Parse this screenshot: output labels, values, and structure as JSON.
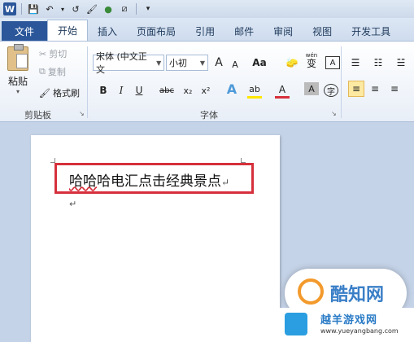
{
  "qat": {
    "app_icon": "W",
    "save_icon": "💾",
    "undo_icon": "↶",
    "undo_arrow": "▾",
    "redo_icon": "↺",
    "format_painter_icon": "🖌",
    "color_icon": "●",
    "pen_icon": "⧄",
    "more_icon": "▾"
  },
  "tabs": [
    "文件",
    "开始",
    "插入",
    "页面布局",
    "引用",
    "邮件",
    "审阅",
    "视图",
    "开发工具"
  ],
  "clipboard": {
    "paste": "粘贴",
    "paste_arrow": "▾",
    "cut": "剪切",
    "cut_icon": "✂",
    "copy": "复制",
    "copy_icon": "⧉",
    "format_painter": "格式刷",
    "format_painter_icon": "🖌",
    "group_label": "剪贴板",
    "launcher": "↘"
  },
  "font": {
    "font_name": "宋体 (中文正文",
    "font_size": "小初",
    "grow": "A",
    "shrink": "A",
    "change_case": "Aa",
    "clear_format": "🧽",
    "phonetic": "wén",
    "phonetic_char": "变",
    "char_border": "A",
    "bold": "B",
    "italic": "I",
    "underline": "U",
    "strikethrough": "abc",
    "subscript": "x₂",
    "superscript": "x²",
    "text_effects": "A",
    "highlight": "ab",
    "font_color": "A",
    "char_shading": "A",
    "enclose_char": "字",
    "group_label": "字体",
    "launcher": "↘"
  },
  "paragraph": {
    "bullets": "☰",
    "numbering": "☷",
    "multilevel": "☱",
    "align_left": "≡",
    "align_center": "≡",
    "align_right": "≡"
  },
  "document": {
    "text": "哈哈哈电汇点击经典景点",
    "squiggle_part": "哈哈",
    "para_mark": "↵",
    "para2_mark": "↵"
  },
  "watermark": {
    "title": "酷知网",
    "name": "越羊游戏网",
    "url": "www.yueyangbang.com"
  },
  "colors": {
    "file_tab": "#2b579a",
    "highlight_box": "#d6303c",
    "active_button": "#fde9a1",
    "background": "#c5d3e8"
  }
}
